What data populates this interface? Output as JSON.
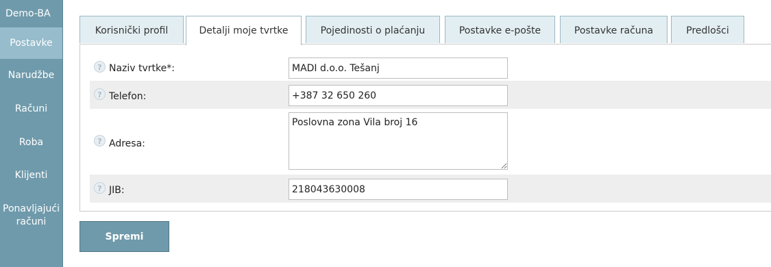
{
  "sidebar": {
    "brand": "Demo-BA",
    "items": [
      {
        "label": "Postavke"
      },
      {
        "label": "Narudžbe"
      },
      {
        "label": "Računi"
      },
      {
        "label": "Roba"
      },
      {
        "label": "Klijenti"
      },
      {
        "label_line1": "Ponavljajući",
        "label_line2": "računi"
      }
    ]
  },
  "tabs": [
    {
      "label": "Korisnički profil"
    },
    {
      "label": "Detalji moje tvrtke"
    },
    {
      "label": "Pojedinosti o plaćanju"
    },
    {
      "label": "Postavke e-pošte"
    },
    {
      "label": "Postavke računa"
    },
    {
      "label": "Predlošci"
    }
  ],
  "form": {
    "help_glyph": "?",
    "company_name": {
      "label": "Naziv tvrtke*:",
      "value": "MADI d.o.o. Tešanj"
    },
    "phone": {
      "label": "Telefon:",
      "value": "+387 32 650 260"
    },
    "address": {
      "label": "Adresa:",
      "value": "Poslovna zona Vila broj 16"
    },
    "jib": {
      "label": "JIB:",
      "value": "218043630008"
    }
  },
  "save_label": "Spremi"
}
